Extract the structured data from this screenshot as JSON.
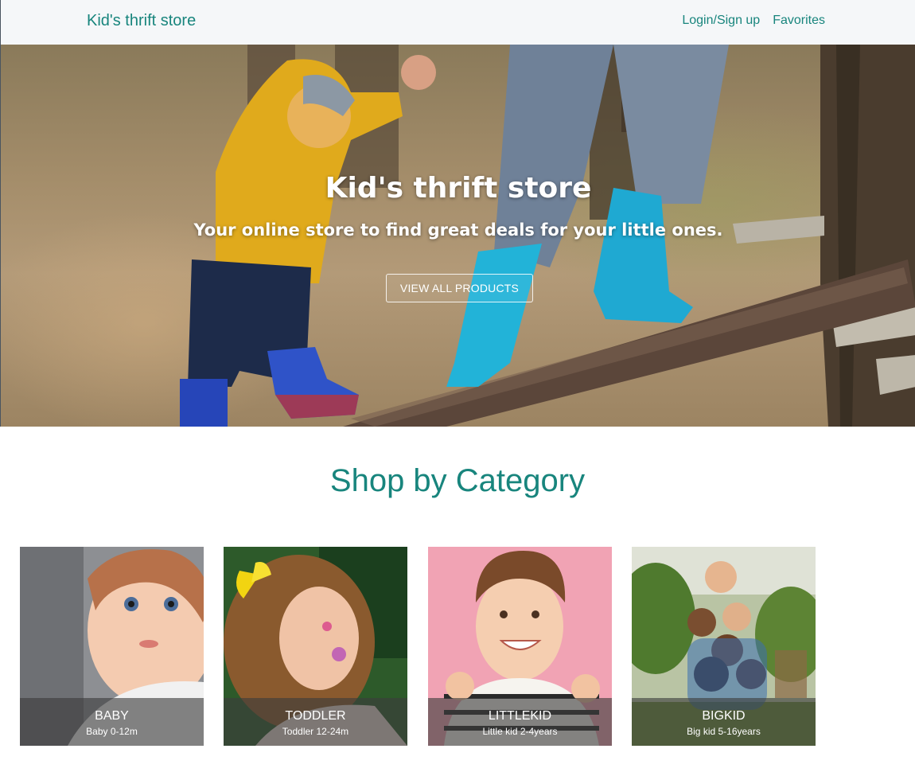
{
  "navbar": {
    "brand": "Kid's thrift store",
    "links": [
      "Login/Sign up",
      "Favorites"
    ]
  },
  "hero": {
    "title": "Kid's thrift store",
    "subtitle": "Your online store to find great deals for your little ones.",
    "button_label": "VIEW ALL PRODUCTS"
  },
  "categories": {
    "title": "Shop by Category",
    "items": [
      {
        "name": "BABY",
        "description": "Baby 0-12m"
      },
      {
        "name": "TODDLER",
        "description": "Toddler 12-24m"
      },
      {
        "name": "LITTLEKID",
        "description": "Little kid 2-4years"
      },
      {
        "name": "BIGKID",
        "description": "Big kid 5-16years"
      }
    ]
  },
  "colors": {
    "brand": "#18857d",
    "navbar_bg": "#f5f7f9",
    "caption_overlay": "#3c3c3c"
  }
}
